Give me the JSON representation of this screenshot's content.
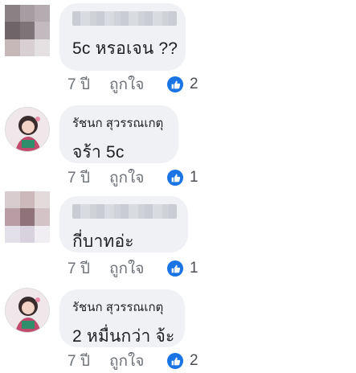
{
  "comments": [
    {
      "author": "",
      "text": "5c หรอเจน ??",
      "age": "7 ปี",
      "like_label": "ถูกใจ",
      "reactions": "2",
      "avatar": "pixelated",
      "name_blurred": true
    },
    {
      "author": "รัชนก สุวรรณเกตุ",
      "text": "จร้า 5c",
      "age": "7 ปี",
      "like_label": "ถูกใจ",
      "reactions": "1",
      "avatar": "photo",
      "name_blurred": false
    },
    {
      "author": "",
      "text": "กี่บาทอ่ะ",
      "age": "7 ปี",
      "like_label": "ถูกใจ",
      "reactions": "1",
      "avatar": "pixelated",
      "name_blurred": true
    },
    {
      "author": "รัชนก สุวรรณเกตุ",
      "text": "2 หมื่นกว่า จ้ะ",
      "age": "7 ปี",
      "like_label": "ถูกใจ",
      "reactions": "2",
      "avatar": "photo",
      "name_blurred": false
    }
  ],
  "colors": {
    "bubble": "#eff1f4",
    "like_blue": "#1b74e4",
    "meta_text": "#6d7178"
  },
  "icons": {
    "reaction": "thumbs-up-icon"
  }
}
